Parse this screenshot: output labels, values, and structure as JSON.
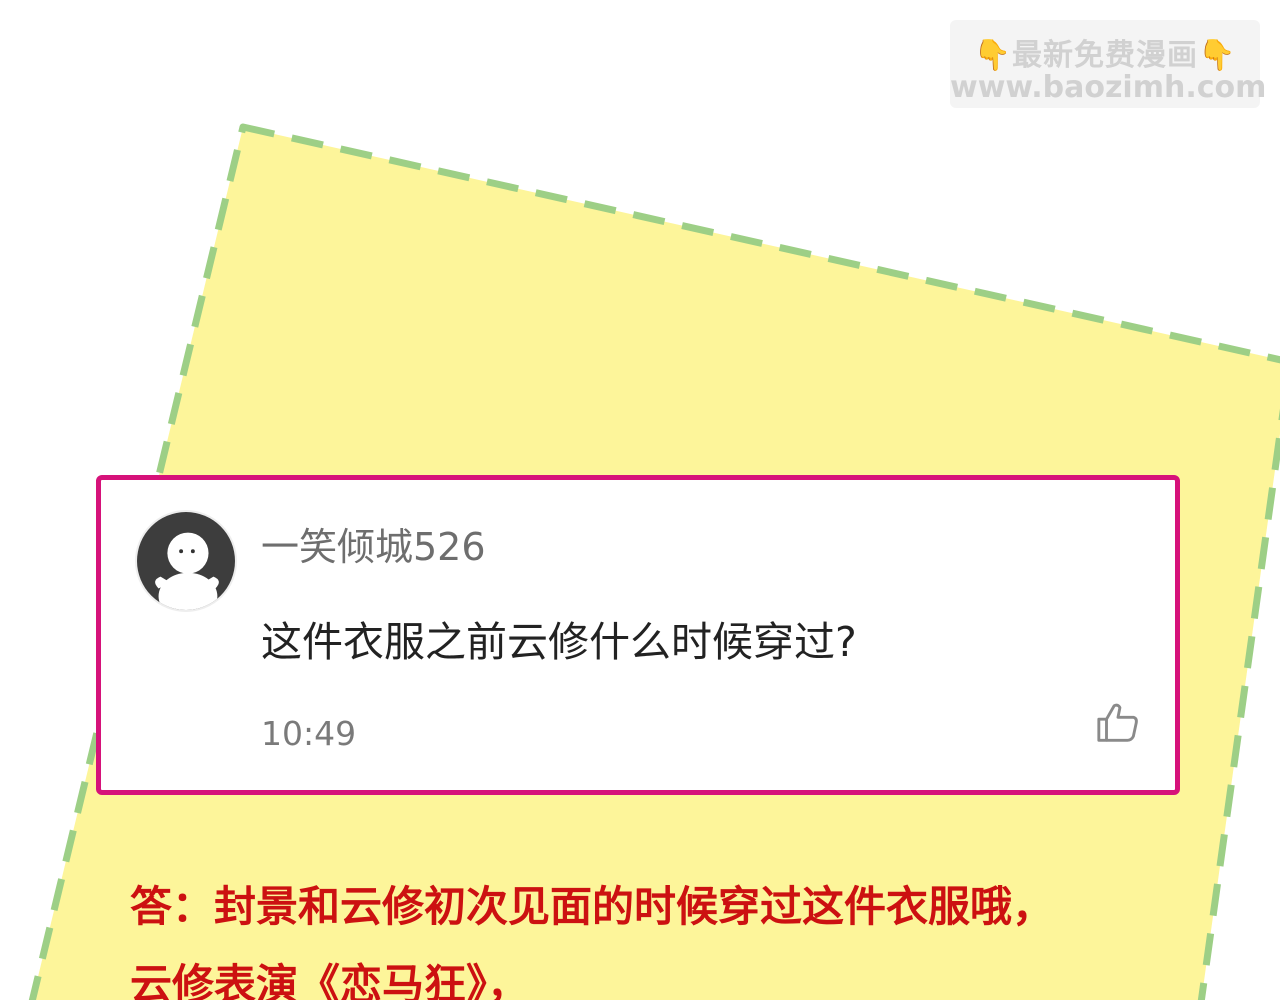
{
  "watermark": {
    "icon_left": "pointing-down-hand-icon",
    "title": "最新免费漫画",
    "icon_right": "pointing-down-hand-icon",
    "url": "www.baozimh.com"
  },
  "comment": {
    "avatar_icon": "default-user-avatar-icon",
    "username": "一笑倾城526",
    "text": "这件衣服之前云修什么时候穿过?",
    "time": "10:49",
    "like_icon": "thumbs-up-icon"
  },
  "answer": {
    "line1": "答：封景和云修初次见面的时候穿过这件衣服哦，",
    "line2": "云修表演《恋马狂》，"
  },
  "colors": {
    "note_fill": "#fdf59a",
    "note_border": "#9dcf86",
    "card_border": "#d6127a",
    "answer_text": "#cc1111"
  }
}
